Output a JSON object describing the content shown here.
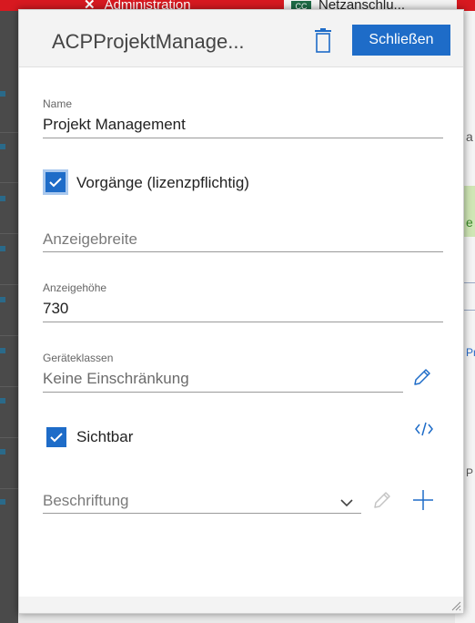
{
  "background": {
    "tab_admin_label": "Administration",
    "tab_netz_label": "Netzanschlu...",
    "tab_netz_icon_text": "CC",
    "right_texts": [
      "a",
      "e",
      "Pr",
      "P"
    ]
  },
  "dialog": {
    "title": "ACPProjektManage...",
    "close_label": "Schließen",
    "fields": {
      "name_label": "Name",
      "name_value": "Projekt Management",
      "vorgaenge_label": "Vorgänge (lizenzpflichtig)",
      "vorgaenge_checked": true,
      "anzeigebreite_placeholder": "Anzeigebreite",
      "anzeigehoehe_label": "Anzeigehöhe",
      "anzeigehoehe_value": "730",
      "geraeteklassen_label": "Geräteklassen",
      "geraeteklassen_value": "Keine Einschränkung",
      "sichtbar_label": "Sichtbar",
      "sichtbar_checked": true,
      "beschriftung_placeholder": "Beschriftung"
    }
  },
  "colors": {
    "accent": "#1e6cc8",
    "topbar": "#d71920"
  }
}
